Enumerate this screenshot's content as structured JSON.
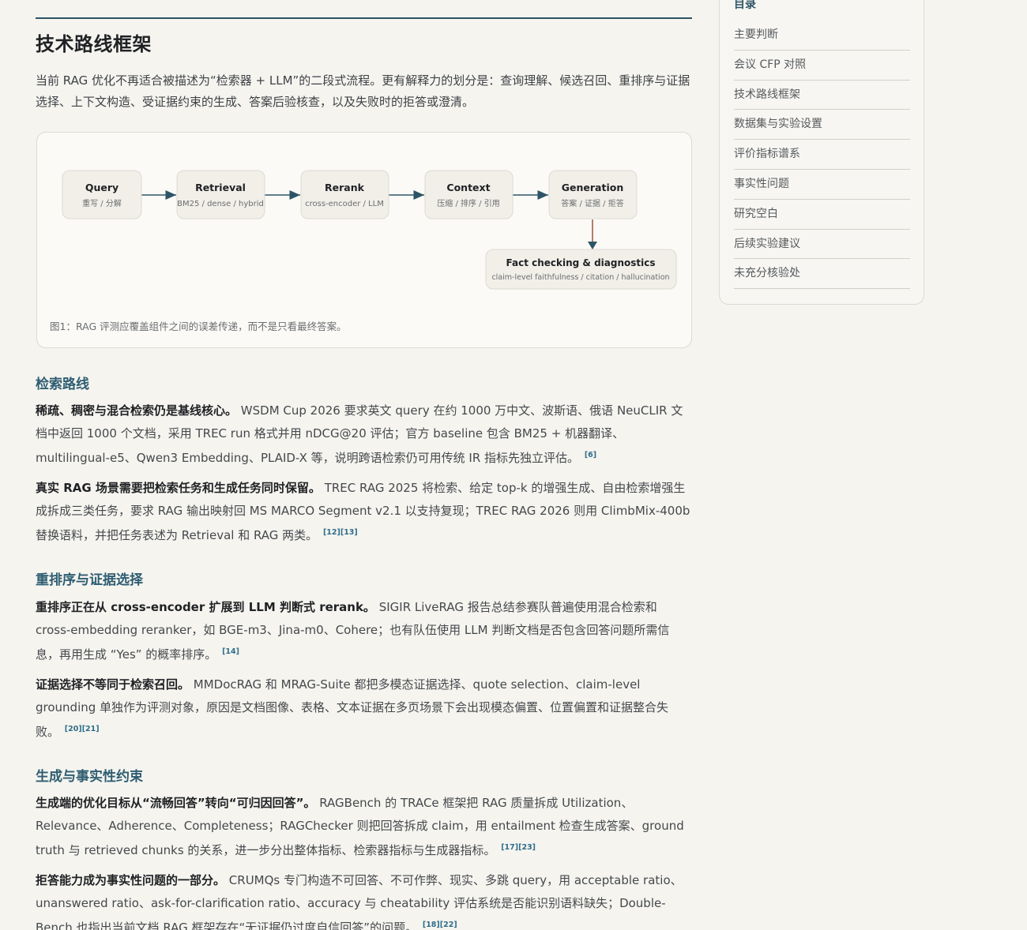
{
  "section": {
    "title": "技术路线框架",
    "intro": "当前 RAG 优化不再适合被描述为“检索器 + LLM”的二段式流程。更有解释力的划分是：查询理解、候选召回、重排序与证据选择、上下文构造、受证据约束的生成、答案后验核查，以及失败时的拒答或澄清。"
  },
  "figure": {
    "nodes": [
      {
        "title": "Query",
        "sub": "重写 / 分解"
      },
      {
        "title": "Retrieval",
        "sub": "BM25 / dense / hybrid"
      },
      {
        "title": "Rerank",
        "sub": "cross-encoder / LLM"
      },
      {
        "title": "Context",
        "sub": "压缩 / 排序 / 引用"
      },
      {
        "title": "Generation",
        "sub": "答案 / 证据 / 拒答"
      },
      {
        "title": "Fact checking & diagnostics",
        "sub": "claim-level faithfulness / citation / hallucination"
      }
    ],
    "caption": "图1：RAG 评测应覆盖组件之间的误差传递，而不是只看最终答案。"
  },
  "subsections": [
    {
      "heading": "检索路线",
      "paragraphs": [
        {
          "lead": "稀疏、稠密与混合检索仍是基线核心。",
          "body": "WSDM Cup 2026 要求英文 query 在约 1000 万中文、波斯语、俄语 NeuCLIR 文档中返回 1000 个文档，采用 TREC run 格式并用 nDCG@20 评估；官方 baseline 包含 BM25 + 机器翻译、multilingual-e5、Qwen3 Embedding、PLAID-X 等，说明跨语检索仍可用传统 IR 指标先独立评估。",
          "cite": "[6]"
        },
        {
          "lead": "真实 RAG 场景需要把检索任务和生成任务同时保留。",
          "body": "TREC RAG 2025 将检索、给定 top-k 的增强生成、自由检索增强生成拆成三类任务，要求 RAG 输出映射回 MS MARCO Segment v2.1 以支持复现；TREC RAG 2026 则用 ClimbMix-400b 替换语料，并把任务表述为 Retrieval 和 RAG 两类。",
          "cite": "[12][13]"
        }
      ]
    },
    {
      "heading": "重排序与证据选择",
      "paragraphs": [
        {
          "lead": "重排序正在从 cross-encoder 扩展到 LLM 判断式 rerank。",
          "body": "SIGIR LiveRAG 报告总结参赛队普遍使用混合检索和 cross-embedding reranker，如 BGE-m3、Jina-m0、Cohere；也有队伍使用 LLM 判断文档是否包含回答问题所需信息，再用生成 “Yes” 的概率排序。",
          "cite": "[14]"
        },
        {
          "lead": "证据选择不等同于检索召回。",
          "body": "MMDocRAG 和 MRAG-Suite 都把多模态证据选择、quote selection、claim-level grounding 单独作为评测对象，原因是文档图像、表格、文本证据在多页场景下会出现模态偏置、位置偏置和证据整合失败。",
          "cite": "[20][21]"
        }
      ]
    },
    {
      "heading": "生成与事实性约束",
      "paragraphs": [
        {
          "lead": "生成端的优化目标从“流畅回答”转向“可归因回答”。",
          "body": "RAGBench 的 TRACe 框架把 RAG 质量拆成 Utilization、Relevance、Adherence、Completeness；RAGChecker 则把回答拆成 claim，用 entailment 检查生成答案、ground truth 与 retrieved chunks 的关系，进一步分出整体指标、检索器指标与生成器指标。",
          "cite": "[17][23]"
        },
        {
          "lead": "拒答能力成为事实性问题的一部分。",
          "body": "CRUMQs 专门构造不可回答、不可作弊、现实、多跳 query，用 acceptable ratio、unanswered ratio、ask-for-clarification ratio、accuracy 与 cheatability 评估系统是否能识别语料缺失；Double-Bench 也指出当前文档 RAG 框架存在“无证据仍过度自信回答”的问题。",
          "cite": "[18][22]"
        }
      ]
    }
  ],
  "toc": {
    "title": "目录",
    "items": [
      "主要判断",
      "会议 CFP 对照",
      "技术路线框架",
      "数据集与实验设置",
      "评价指标谱系",
      "事实性问题",
      "研究空白",
      "后续实验建议",
      "未充分核验处"
    ]
  },
  "colors": {
    "accent": "#2e5d72",
    "arrow": "#2d5466",
    "feedback_arrow": "#a0523a",
    "background": "#f5f4ef"
  }
}
